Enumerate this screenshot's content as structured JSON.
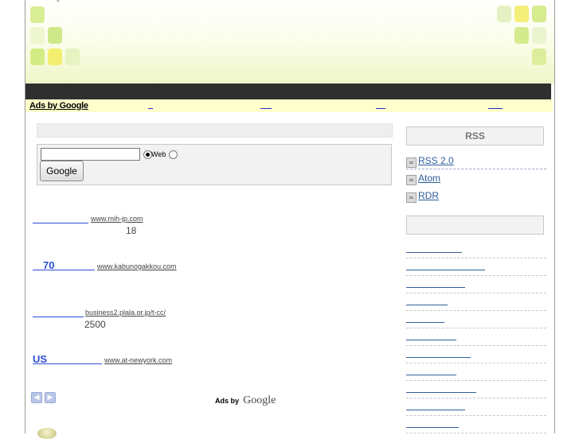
{
  "header": {
    "decor": "green-square-pattern",
    "dash_mark": "-"
  },
  "adbar": {
    "ads_by_google": "Ads by Google"
  },
  "search": {
    "input_value": "",
    "web_label": "Web",
    "button_label": "Google",
    "web_selected": true
  },
  "ads": [
    {
      "title": "",
      "url": "www.mih-jp.com",
      "desc": "18"
    },
    {
      "title": "70",
      "url": "www.kabunogakkou.com",
      "desc": ""
    },
    {
      "title": "",
      "url": "business2.plala.or.jp/t-cc/",
      "desc": "2500"
    },
    {
      "title": "US",
      "url": "www.at-newyork.com",
      "desc": ""
    }
  ],
  "ad_footer": {
    "ads_by": "Ads by",
    "google": "Google",
    "prev_icon": "chevron-left-icon",
    "next_icon": "chevron-right-icon"
  },
  "sidebar": {
    "rss_header": "RSS",
    "feeds": [
      {
        "label": "RSS 2.0",
        "icon": "feed-icon"
      },
      {
        "label": "Atom",
        "icon": "feed-icon"
      },
      {
        "label": "RDR",
        "icon": "feed-icon"
      }
    ],
    "second_header": "",
    "items": [
      "",
      "",
      "",
      "",
      "",
      "",
      "",
      "",
      "",
      "",
      ""
    ]
  },
  "colors": {
    "link": "#2b4ed6",
    "dark_bar": "#2f2f2f",
    "ad_bar": "#ffffcc",
    "square_green": "#d6ec8e",
    "square_yellow": "#f5f06b"
  }
}
